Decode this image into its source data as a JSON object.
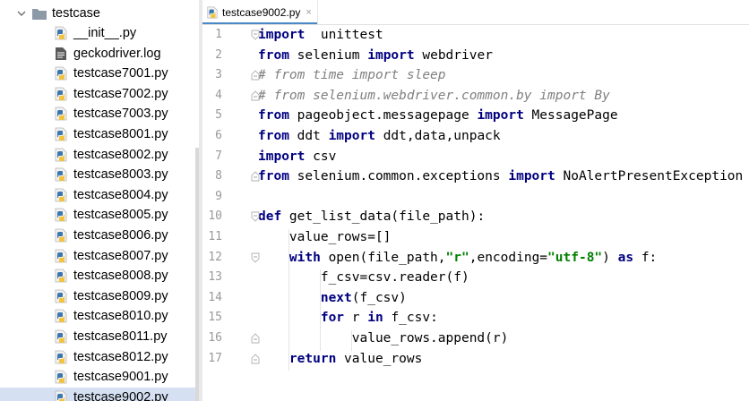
{
  "project_tree": {
    "folder_name": "testcase",
    "files": [
      {
        "name": "__init__.py",
        "type": "py"
      },
      {
        "name": "geckodriver.log",
        "type": "log"
      },
      {
        "name": "testcase7001.py",
        "type": "py"
      },
      {
        "name": "testcase7002.py",
        "type": "py"
      },
      {
        "name": "testcase7003.py",
        "type": "py"
      },
      {
        "name": "testcase8001.py",
        "type": "py"
      },
      {
        "name": "testcase8002.py",
        "type": "py"
      },
      {
        "name": "testcase8003.py",
        "type": "py"
      },
      {
        "name": "testcase8004.py",
        "type": "py"
      },
      {
        "name": "testcase8005.py",
        "type": "py"
      },
      {
        "name": "testcase8006.py",
        "type": "py"
      },
      {
        "name": "testcase8007.py",
        "type": "py"
      },
      {
        "name": "testcase8008.py",
        "type": "py"
      },
      {
        "name": "testcase8009.py",
        "type": "py"
      },
      {
        "name": "testcase8010.py",
        "type": "py"
      },
      {
        "name": "testcase8011.py",
        "type": "py"
      },
      {
        "name": "testcase8012.py",
        "type": "py"
      },
      {
        "name": "testcase9001.py",
        "type": "py"
      },
      {
        "name": "testcase9002.py",
        "type": "py",
        "selected": true
      }
    ]
  },
  "editor": {
    "tab_label": "testcase9002.py",
    "tab_close": "×",
    "lines": [
      {
        "n": "1",
        "tokens": [
          [
            "kw",
            "import"
          ],
          [
            "",
            "  unittest"
          ]
        ]
      },
      {
        "n": "2",
        "tokens": [
          [
            "kw",
            "from"
          ],
          [
            "",
            " selenium "
          ],
          [
            "kw",
            "import"
          ],
          [
            "",
            " webdriver"
          ]
        ]
      },
      {
        "n": "3",
        "tokens": [
          [
            "cm",
            "# from time import sleep"
          ]
        ]
      },
      {
        "n": "4",
        "tokens": [
          [
            "cm",
            "# from selenium.webdriver.common.by import By"
          ]
        ]
      },
      {
        "n": "5",
        "tokens": [
          [
            "kw",
            "from"
          ],
          [
            "",
            " pageobject.messagepage "
          ],
          [
            "kw",
            "import"
          ],
          [
            "",
            " MessagePage"
          ]
        ]
      },
      {
        "n": "6",
        "tokens": [
          [
            "kw",
            "from"
          ],
          [
            "",
            " ddt "
          ],
          [
            "kw",
            "import"
          ],
          [
            "",
            " ddt,data,unpack"
          ]
        ]
      },
      {
        "n": "7",
        "tokens": [
          [
            "kw",
            "import"
          ],
          [
            "",
            " csv"
          ]
        ]
      },
      {
        "n": "8",
        "tokens": [
          [
            "kw",
            "from"
          ],
          [
            "",
            " selenium.common.exceptions "
          ],
          [
            "kw",
            "import"
          ],
          [
            "",
            " NoAlertPresentException"
          ]
        ]
      },
      {
        "n": "9",
        "tokens": []
      },
      {
        "n": "10",
        "tokens": [
          [
            "kw",
            "def"
          ],
          [
            "",
            " get_list_data(file_path):"
          ]
        ]
      },
      {
        "n": "11",
        "tokens": [
          [
            "",
            "    value_rows=[]"
          ]
        ]
      },
      {
        "n": "12",
        "tokens": [
          [
            "",
            "    "
          ],
          [
            "kw",
            "with"
          ],
          [
            "",
            " open(file_path,"
          ],
          [
            "st",
            "\"r\""
          ],
          [
            "",
            ",encoding="
          ],
          [
            "st",
            "\"utf-8\""
          ],
          [
            "",
            ") "
          ],
          [
            "kw",
            "as"
          ],
          [
            "",
            " f:"
          ]
        ]
      },
      {
        "n": "13",
        "tokens": [
          [
            "",
            "        f_csv=csv.reader(f)"
          ]
        ]
      },
      {
        "n": "14",
        "tokens": [
          [
            "",
            "        "
          ],
          [
            "kw",
            "next"
          ],
          [
            "",
            "(f_csv)"
          ]
        ]
      },
      {
        "n": "15",
        "tokens": [
          [
            "",
            "        "
          ],
          [
            "kw",
            "for"
          ],
          [
            "",
            " r "
          ],
          [
            "kw",
            "in"
          ],
          [
            "",
            " f_csv:"
          ]
        ]
      },
      {
        "n": "16",
        "tokens": [
          [
            "",
            "            value_rows.append(r)"
          ]
        ]
      },
      {
        "n": "17",
        "tokens": [
          [
            "",
            "    "
          ],
          [
            "kw",
            "return"
          ],
          [
            "",
            " value_rows"
          ]
        ]
      }
    ]
  },
  "colors": {
    "keyword": "#000080",
    "comment": "#808080",
    "string": "#008000",
    "selection": "#d5e1f3",
    "tab_underline": "#4a88c7"
  },
  "icons": {
    "tree_toggle": "chevron-down-icon",
    "folder": "folder-icon",
    "python_file": "python-file-icon",
    "log_file": "log-file-icon",
    "close": "close-icon"
  }
}
